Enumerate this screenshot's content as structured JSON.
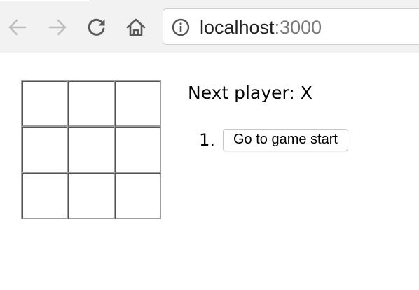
{
  "browser": {
    "url_host": "localhost",
    "url_port": ":3000",
    "icons": [
      "back-arrow-icon",
      "forward-arrow-icon",
      "reload-icon",
      "home-icon",
      "info-icon"
    ]
  },
  "game": {
    "squares": [
      "",
      "",
      "",
      "",
      "",
      "",
      "",
      "",
      ""
    ],
    "status": "Next player: X",
    "moves": [
      {
        "number": "1.",
        "label": "Go to game start"
      }
    ]
  }
}
